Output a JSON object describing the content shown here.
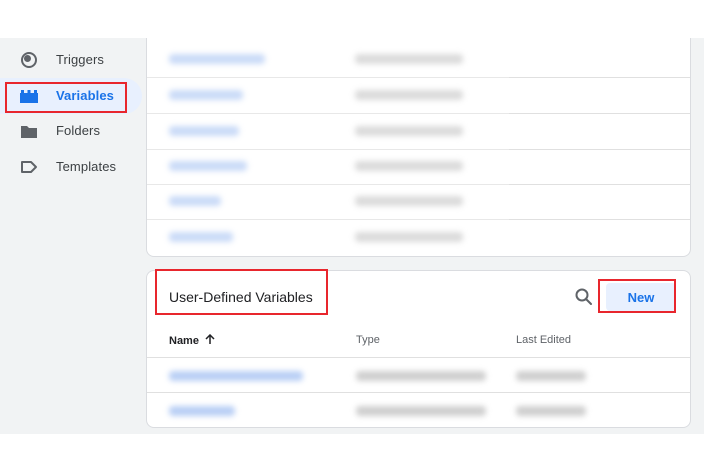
{
  "sidebar": {
    "items": [
      {
        "label": "Triggers",
        "icon": "triggers-icon",
        "active": false
      },
      {
        "label": "Variables",
        "icon": "variables-icon",
        "active": true
      },
      {
        "label": "Folders",
        "icon": "folder-icon",
        "active": false
      },
      {
        "label": "Templates",
        "icon": "template-icon",
        "active": false
      }
    ]
  },
  "user_defined": {
    "title": "User-Defined Variables",
    "new_label": "New",
    "columns": {
      "name": "Name",
      "type": "Type",
      "last_edited": "Last Edited"
    },
    "sort_icon": "arrow-up-icon"
  },
  "colors": {
    "accent": "#1a73e8",
    "active_bg": "#e8f0fe",
    "highlight": "#e8262d",
    "page_bg": "#f1f3f4"
  }
}
